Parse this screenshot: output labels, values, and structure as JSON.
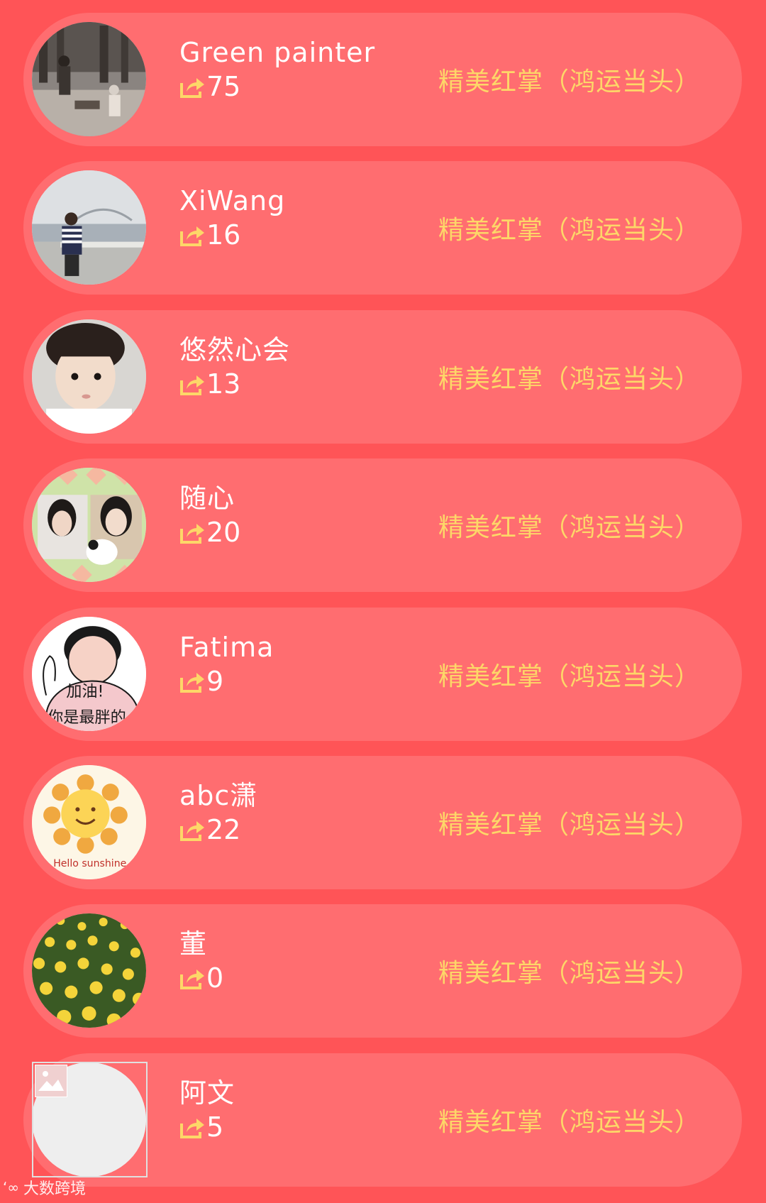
{
  "entries": [
    {
      "name": "Green painter",
      "count": "75",
      "product": "精美红掌（鸿运当头）",
      "avatar": "street-photo-avatar"
    },
    {
      "name": "XiWang",
      "count": "16",
      "product": "精美红掌（鸿运当头）",
      "avatar": "lakeside-photo-avatar"
    },
    {
      "name": "悠然心会",
      "count": "13",
      "product": "精美红掌（鸿运当头）",
      "avatar": "child-photo-avatar"
    },
    {
      "name": "随心",
      "count": "20",
      "product": "精美红掌（鸿运当头）",
      "avatar": "two-women-photo-avatar"
    },
    {
      "name": "Fatima",
      "count": "9",
      "product": "精美红掌（鸿运当头）",
      "avatar": "cartoon-girl-avatar"
    },
    {
      "name": "abc潇",
      "count": "22",
      "product": "精美红掌（鸿运当头）",
      "avatar": "sunshine-avatar"
    },
    {
      "name": "董",
      "count": "0",
      "product": "精美红掌（鸿运当头）",
      "avatar": "tulip-field-avatar"
    },
    {
      "name": "阿文",
      "count": "5",
      "product": "精美红掌（鸿运当头）",
      "avatar": "placeholder-avatar"
    }
  ],
  "avatar_texts": {
    "cartoon_line1": "加油!",
    "cartoon_line2": "你是最胖的",
    "sunshine": "Hello sunshine"
  },
  "watermark": {
    "text": "大数跨境"
  },
  "colors": {
    "background": "#ff5457",
    "card": "#ff6d70",
    "product_text": "#fdd768",
    "share_icon": "#fdd768"
  }
}
